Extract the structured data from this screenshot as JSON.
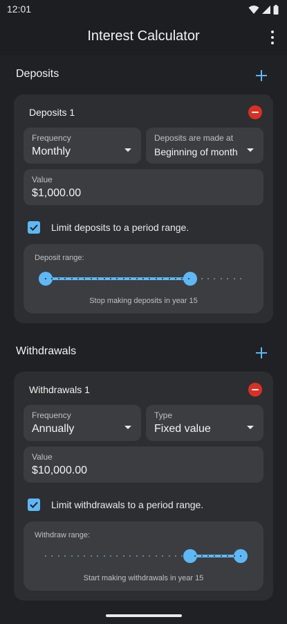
{
  "status_bar": {
    "time": "12:01",
    "icons": [
      "wifi-icon",
      "signal-icon",
      "battery-icon"
    ]
  },
  "app_bar": {
    "title": "Interest Calculator",
    "menu_icon": "more-vert-icon"
  },
  "colors": {
    "accent": "#5eb8f5",
    "remove": "#d93025",
    "background": "#202124",
    "card": "#2d2e31",
    "field": "#3c3d41"
  },
  "deposits": {
    "title": "Deposits",
    "add_icon": "plus-icon",
    "card": {
      "title": "Deposits 1",
      "frequency_label": "Frequency",
      "frequency_value": "Monthly",
      "timing_label": "Deposits are made at",
      "timing_value": "Beginning of month",
      "value_label": "Value",
      "value": "$1,000.00",
      "limit_checked": true,
      "limit_label": "Limit deposits to a period range.",
      "range_label": "Deposit range:",
      "range_caption": "Stop making deposits in year 15",
      "range_start_fraction": 0.0,
      "range_end_fraction": 0.74
    }
  },
  "withdrawals": {
    "title": "Withdrawals",
    "add_icon": "plus-icon",
    "card": {
      "title": "Withdrawals 1",
      "frequency_label": "Frequency",
      "frequency_value": "Annually",
      "type_label": "Type",
      "type_value": "Fixed value",
      "value_label": "Value",
      "value": "$10,000.00",
      "limit_checked": true,
      "limit_label": "Limit withdrawals to a period range.",
      "range_label": "Withdraw range:",
      "range_caption": "Start making withdrawals in year 15",
      "range_start_fraction": 0.74,
      "range_end_fraction": 1.0
    }
  }
}
